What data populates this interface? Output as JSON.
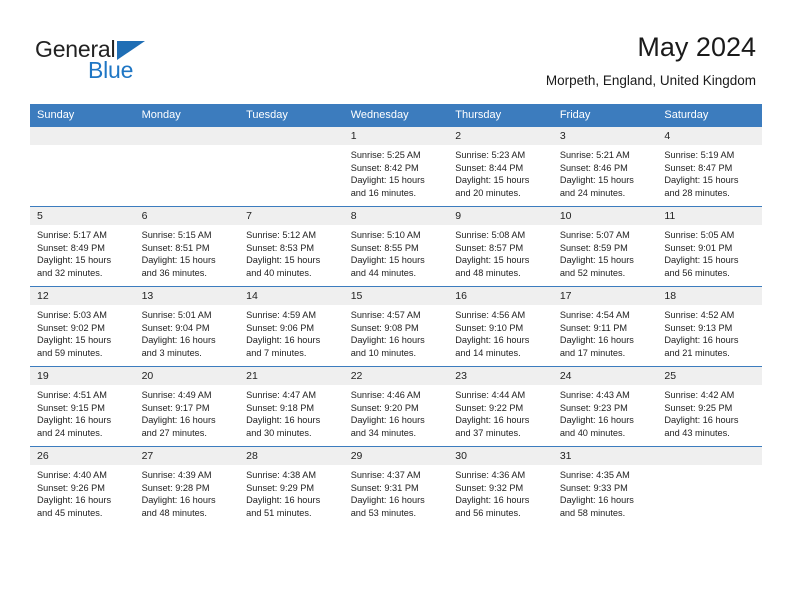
{
  "brand": {
    "name_part1": "General",
    "name_part2": "Blue",
    "triangle_color": "#1f6eb5",
    "blue_color": "#1f76c4"
  },
  "header": {
    "title": "May 2024",
    "subtitle": "Morpeth, England, United Kingdom"
  },
  "theme": {
    "header_blue": "#3c7cbe",
    "daynum_band": "#efefef",
    "text": "#222222"
  },
  "weekday_headers": [
    "Sunday",
    "Monday",
    "Tuesday",
    "Wednesday",
    "Thursday",
    "Friday",
    "Saturday"
  ],
  "labels": {
    "sunrise": "Sunrise:",
    "sunset": "Sunset:",
    "daylight": "Daylight:"
  },
  "weeks": [
    [
      {
        "day": "",
        "blank": true,
        "sunrise": "",
        "sunset": "",
        "daylight_line1": "",
        "daylight_line2": ""
      },
      {
        "day": "",
        "blank": true,
        "sunrise": "",
        "sunset": "",
        "daylight_line1": "",
        "daylight_line2": ""
      },
      {
        "day": "",
        "blank": true,
        "sunrise": "",
        "sunset": "",
        "daylight_line1": "",
        "daylight_line2": ""
      },
      {
        "day": "1",
        "blank": false,
        "sunrise": "Sunrise: 5:25 AM",
        "sunset": "Sunset: 8:42 PM",
        "daylight_line1": "Daylight: 15 hours",
        "daylight_line2": "and 16 minutes."
      },
      {
        "day": "2",
        "blank": false,
        "sunrise": "Sunrise: 5:23 AM",
        "sunset": "Sunset: 8:44 PM",
        "daylight_line1": "Daylight: 15 hours",
        "daylight_line2": "and 20 minutes."
      },
      {
        "day": "3",
        "blank": false,
        "sunrise": "Sunrise: 5:21 AM",
        "sunset": "Sunset: 8:46 PM",
        "daylight_line1": "Daylight: 15 hours",
        "daylight_line2": "and 24 minutes."
      },
      {
        "day": "4",
        "blank": false,
        "sunrise": "Sunrise: 5:19 AM",
        "sunset": "Sunset: 8:47 PM",
        "daylight_line1": "Daylight: 15 hours",
        "daylight_line2": "and 28 minutes."
      }
    ],
    [
      {
        "day": "5",
        "blank": false,
        "sunrise": "Sunrise: 5:17 AM",
        "sunset": "Sunset: 8:49 PM",
        "daylight_line1": "Daylight: 15 hours",
        "daylight_line2": "and 32 minutes."
      },
      {
        "day": "6",
        "blank": false,
        "sunrise": "Sunrise: 5:15 AM",
        "sunset": "Sunset: 8:51 PM",
        "daylight_line1": "Daylight: 15 hours",
        "daylight_line2": "and 36 minutes."
      },
      {
        "day": "7",
        "blank": false,
        "sunrise": "Sunrise: 5:12 AM",
        "sunset": "Sunset: 8:53 PM",
        "daylight_line1": "Daylight: 15 hours",
        "daylight_line2": "and 40 minutes."
      },
      {
        "day": "8",
        "blank": false,
        "sunrise": "Sunrise: 5:10 AM",
        "sunset": "Sunset: 8:55 PM",
        "daylight_line1": "Daylight: 15 hours",
        "daylight_line2": "and 44 minutes."
      },
      {
        "day": "9",
        "blank": false,
        "sunrise": "Sunrise: 5:08 AM",
        "sunset": "Sunset: 8:57 PM",
        "daylight_line1": "Daylight: 15 hours",
        "daylight_line2": "and 48 minutes."
      },
      {
        "day": "10",
        "blank": false,
        "sunrise": "Sunrise: 5:07 AM",
        "sunset": "Sunset: 8:59 PM",
        "daylight_line1": "Daylight: 15 hours",
        "daylight_line2": "and 52 minutes."
      },
      {
        "day": "11",
        "blank": false,
        "sunrise": "Sunrise: 5:05 AM",
        "sunset": "Sunset: 9:01 PM",
        "daylight_line1": "Daylight: 15 hours",
        "daylight_line2": "and 56 minutes."
      }
    ],
    [
      {
        "day": "12",
        "blank": false,
        "sunrise": "Sunrise: 5:03 AM",
        "sunset": "Sunset: 9:02 PM",
        "daylight_line1": "Daylight: 15 hours",
        "daylight_line2": "and 59 minutes."
      },
      {
        "day": "13",
        "blank": false,
        "sunrise": "Sunrise: 5:01 AM",
        "sunset": "Sunset: 9:04 PM",
        "daylight_line1": "Daylight: 16 hours",
        "daylight_line2": "and 3 minutes."
      },
      {
        "day": "14",
        "blank": false,
        "sunrise": "Sunrise: 4:59 AM",
        "sunset": "Sunset: 9:06 PM",
        "daylight_line1": "Daylight: 16 hours",
        "daylight_line2": "and 7 minutes."
      },
      {
        "day": "15",
        "blank": false,
        "sunrise": "Sunrise: 4:57 AM",
        "sunset": "Sunset: 9:08 PM",
        "daylight_line1": "Daylight: 16 hours",
        "daylight_line2": "and 10 minutes."
      },
      {
        "day": "16",
        "blank": false,
        "sunrise": "Sunrise: 4:56 AM",
        "sunset": "Sunset: 9:10 PM",
        "daylight_line1": "Daylight: 16 hours",
        "daylight_line2": "and 14 minutes."
      },
      {
        "day": "17",
        "blank": false,
        "sunrise": "Sunrise: 4:54 AM",
        "sunset": "Sunset: 9:11 PM",
        "daylight_line1": "Daylight: 16 hours",
        "daylight_line2": "and 17 minutes."
      },
      {
        "day": "18",
        "blank": false,
        "sunrise": "Sunrise: 4:52 AM",
        "sunset": "Sunset: 9:13 PM",
        "daylight_line1": "Daylight: 16 hours",
        "daylight_line2": "and 21 minutes."
      }
    ],
    [
      {
        "day": "19",
        "blank": false,
        "sunrise": "Sunrise: 4:51 AM",
        "sunset": "Sunset: 9:15 PM",
        "daylight_line1": "Daylight: 16 hours",
        "daylight_line2": "and 24 minutes."
      },
      {
        "day": "20",
        "blank": false,
        "sunrise": "Sunrise: 4:49 AM",
        "sunset": "Sunset: 9:17 PM",
        "daylight_line1": "Daylight: 16 hours",
        "daylight_line2": "and 27 minutes."
      },
      {
        "day": "21",
        "blank": false,
        "sunrise": "Sunrise: 4:47 AM",
        "sunset": "Sunset: 9:18 PM",
        "daylight_line1": "Daylight: 16 hours",
        "daylight_line2": "and 30 minutes."
      },
      {
        "day": "22",
        "blank": false,
        "sunrise": "Sunrise: 4:46 AM",
        "sunset": "Sunset: 9:20 PM",
        "daylight_line1": "Daylight: 16 hours",
        "daylight_line2": "and 34 minutes."
      },
      {
        "day": "23",
        "blank": false,
        "sunrise": "Sunrise: 4:44 AM",
        "sunset": "Sunset: 9:22 PM",
        "daylight_line1": "Daylight: 16 hours",
        "daylight_line2": "and 37 minutes."
      },
      {
        "day": "24",
        "blank": false,
        "sunrise": "Sunrise: 4:43 AM",
        "sunset": "Sunset: 9:23 PM",
        "daylight_line1": "Daylight: 16 hours",
        "daylight_line2": "and 40 minutes."
      },
      {
        "day": "25",
        "blank": false,
        "sunrise": "Sunrise: 4:42 AM",
        "sunset": "Sunset: 9:25 PM",
        "daylight_line1": "Daylight: 16 hours",
        "daylight_line2": "and 43 minutes."
      }
    ],
    [
      {
        "day": "26",
        "blank": false,
        "sunrise": "Sunrise: 4:40 AM",
        "sunset": "Sunset: 9:26 PM",
        "daylight_line1": "Daylight: 16 hours",
        "daylight_line2": "and 45 minutes."
      },
      {
        "day": "27",
        "blank": false,
        "sunrise": "Sunrise: 4:39 AM",
        "sunset": "Sunset: 9:28 PM",
        "daylight_line1": "Daylight: 16 hours",
        "daylight_line2": "and 48 minutes."
      },
      {
        "day": "28",
        "blank": false,
        "sunrise": "Sunrise: 4:38 AM",
        "sunset": "Sunset: 9:29 PM",
        "daylight_line1": "Daylight: 16 hours",
        "daylight_line2": "and 51 minutes."
      },
      {
        "day": "29",
        "blank": false,
        "sunrise": "Sunrise: 4:37 AM",
        "sunset": "Sunset: 9:31 PM",
        "daylight_line1": "Daylight: 16 hours",
        "daylight_line2": "and 53 minutes."
      },
      {
        "day": "30",
        "blank": false,
        "sunrise": "Sunrise: 4:36 AM",
        "sunset": "Sunset: 9:32 PM",
        "daylight_line1": "Daylight: 16 hours",
        "daylight_line2": "and 56 minutes."
      },
      {
        "day": "31",
        "blank": false,
        "sunrise": "Sunrise: 4:35 AM",
        "sunset": "Sunset: 9:33 PM",
        "daylight_line1": "Daylight: 16 hours",
        "daylight_line2": "and 58 minutes."
      },
      {
        "day": "",
        "blank": true,
        "sunrise": "",
        "sunset": "",
        "daylight_line1": "",
        "daylight_line2": ""
      }
    ]
  ]
}
